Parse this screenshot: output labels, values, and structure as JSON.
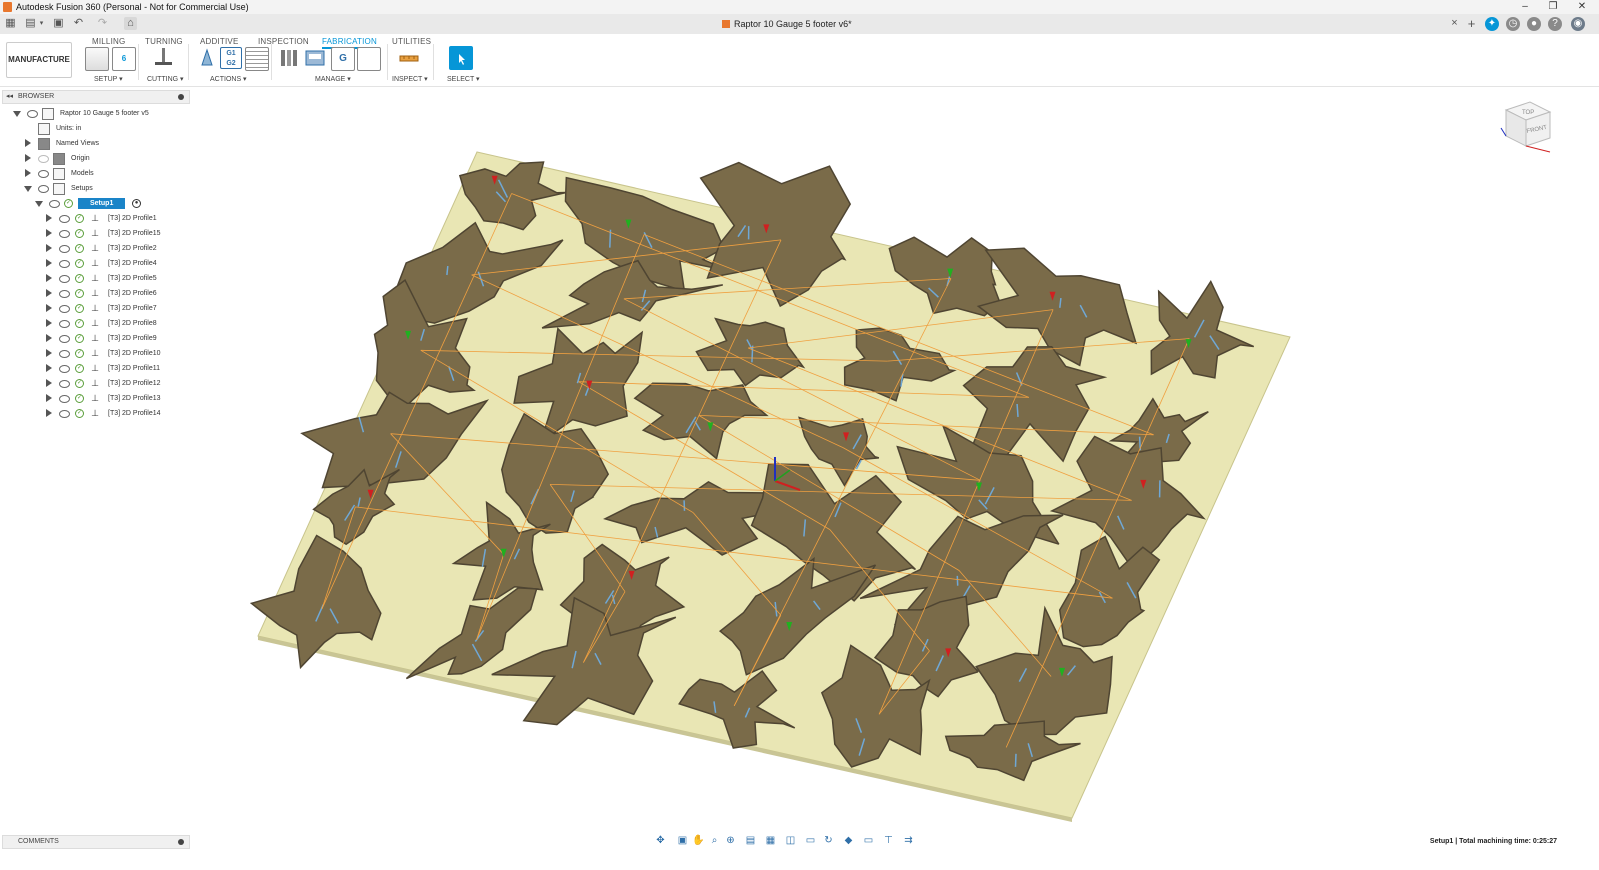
{
  "titlebar": {
    "title": "Autodesk Fusion 360 (Personal - Not for Commercial Use)",
    "minimize": "–",
    "restore": "❐",
    "close": "✕"
  },
  "doc_tab": {
    "title": "Raptor 10 Gauge 5 footer v6*",
    "close": "×"
  },
  "ribbon": {
    "workspace": "MANUFACTURE ▾",
    "tabs": [
      "MILLING",
      "TURNING",
      "ADDITIVE",
      "INSPECTION",
      "FABRICATION",
      "UTILITIES"
    ],
    "active_tab": "FABRICATION",
    "groups": {
      "setup": "SETUP ▾",
      "cutting": "CUTTING ▾",
      "actions": "ACTIONS ▾",
      "manage": "MANAGE ▾",
      "inspect": "INSPECT ▾",
      "select": "SELECT ▾"
    },
    "g1g2": "G1 G2"
  },
  "browser": {
    "header": "BROWSER",
    "root": "Raptor 10 Gauge 5 footer v5",
    "units": "Units: in",
    "named_views": "Named Views",
    "origin": "Origin",
    "models": "Models",
    "setups": "Setups",
    "setup1": "Setup1",
    "operations": [
      "[T3] 2D Profile1",
      "[T3] 2D Profile15",
      "[T3] 2D Profile2",
      "[T3] 2D Profile4",
      "[T3] 2D Profile5",
      "[T3] 2D Profile6",
      "[T3] 2D Profile7",
      "[T3] 2D Profile8",
      "[T3] 2D Profile9",
      "[T3] 2D Profile10",
      "[T3] 2D Profile11",
      "[T3] 2D Profile12",
      "[T3] 2D Profile13",
      "[T3] 2D Profile14"
    ]
  },
  "viewcube": {
    "top": "TOP",
    "front": "FRONT"
  },
  "comments": {
    "label": "COMMENTS"
  },
  "status": {
    "text": "Setup1 | Total machining time: 0:25:27"
  },
  "colors": {
    "accent": "#0696d7",
    "stock": "#e9e6b4",
    "part": "#7a6b49",
    "toolpath": "#f0a040"
  }
}
